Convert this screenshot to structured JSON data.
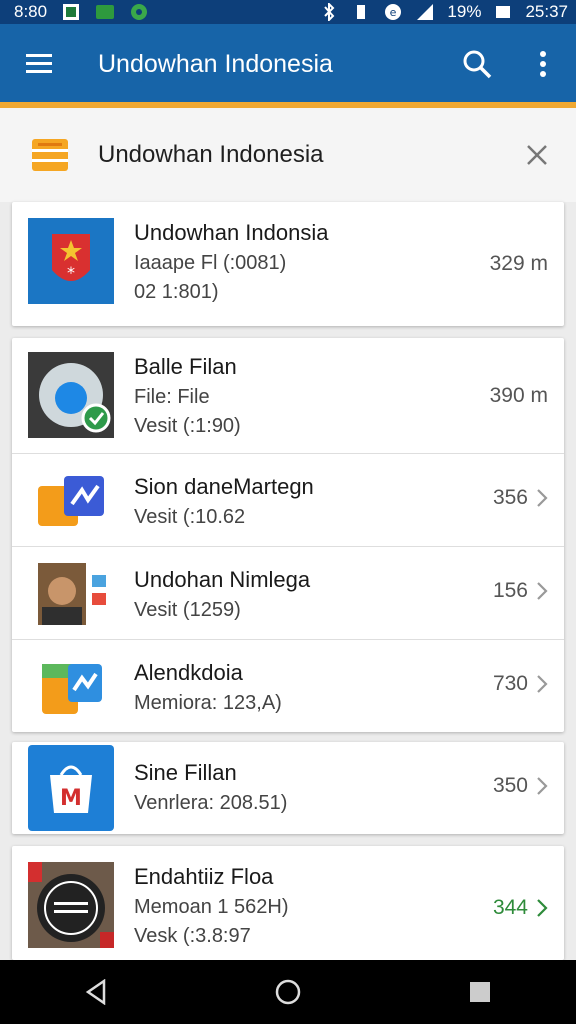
{
  "status_bar": {
    "time": "8:80",
    "battery": "19%",
    "clock": "25:37"
  },
  "app_bar": {
    "title": "Undowhan Indonesia"
  },
  "banner": {
    "title": "Undowhan Indonesia"
  },
  "items": [
    {
      "title": "Undowhan Indonsia",
      "line2": "Iaaape Fl (:0081)",
      "line3": "02 1:801)",
      "value": "329 m",
      "chevron": false,
      "value_color": "#555555"
    },
    {
      "title": "Balle Filan",
      "line2": "File: File",
      "line3": "Vesit (:1:90)",
      "value": "390 m",
      "chevron": false,
      "value_color": "#555555"
    },
    {
      "title": "Sion daneMartegn",
      "line2": "Vesit (:10.62",
      "line3": "",
      "value": "356",
      "chevron": true,
      "value_color": "#555555"
    },
    {
      "title": "Undohan Nimlega",
      "line2": "Vesit (1259)",
      "line3": "",
      "value": "156",
      "chevron": true,
      "value_color": "#555555"
    },
    {
      "title": "Alendkdoia",
      "line2": "Memiora: 123,A)",
      "line3": "",
      "value": "730",
      "chevron": true,
      "value_color": "#555555"
    },
    {
      "title": "Sine Fillan",
      "line2": "Venrlera: 208.51)",
      "line3": "",
      "value": "350",
      "chevron": true,
      "value_color": "#555555"
    },
    {
      "title": "Endahtiiz Floa",
      "line2": "Memoan 1 562H)",
      "line3": "Vesk (:3.8:97",
      "value": "344",
      "chevron": true,
      "value_color": "#2e8b3a"
    }
  ],
  "colors": {
    "app_bar": "#1764a8",
    "status_bar": "#0d3f7a",
    "accent": "#f0a832"
  }
}
